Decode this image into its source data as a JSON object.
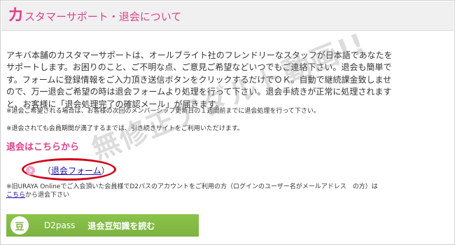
{
  "header": {
    "title_big": "カ",
    "title_rest": "スタマーサポート・退会について"
  },
  "intro_text": "アキバ本舗のカスタマーサポートは、オールブライト社のフレンドリーなスタッフが日本語であなたを\nサポートします。お困りのこと、ご不明な点、ご意見ご希望などいつでもご連絡下さい。退会も簡単で\nす。フォームに登録情報をご入力頂き送信ボタンをクリックするだけでＯＫ。自動で継続課金致しませ\nので、万一退会ご希望の時は退会フォームより処理を行って下さい。退会手続きが正常に処理されます\nと、お客様に「退会処理完了の確認メール」が届きます。",
  "notes": {
    "note1": "※退会ご希望される場合は、お客様の次回のメンバーシップ更新日の１週間前までに退会処理を行って下さい。",
    "note2": "※退会されても会員期間が満了するまでは、引き続きサイトをご利用いただけます。",
    "note3_a": "※旧URAYA Onlineでご入会頂いた会員様でD2パスのアカウントをご利用の方（ログインのユーザー名がメールアドレス　の方）は",
    "note3_link": "こちら",
    "note3_b": "から退会下さい"
  },
  "section_heading": "退会はこちらから",
  "form_link": {
    "open": "（",
    "label": "退会フォーム",
    "close": "）"
  },
  "d2_banner": {
    "badge": "豆",
    "name": "D2pass",
    "text": "退会豆知識を読む"
  },
  "watermark": "無修正アダルト動画!!",
  "colors": {
    "accent": "#e0418c",
    "link": "#1a0dab",
    "highlight_oval": "#d0021b",
    "banner_green": "#7cb342"
  }
}
